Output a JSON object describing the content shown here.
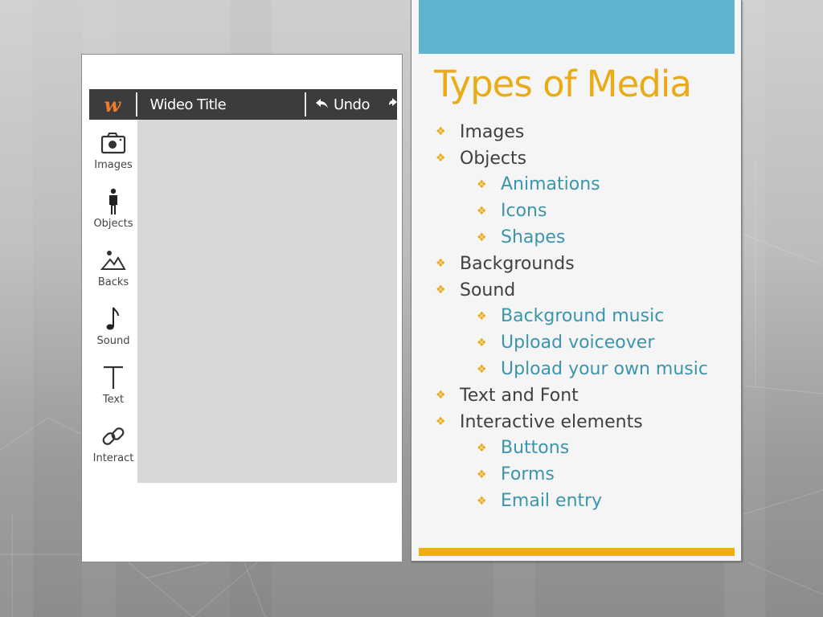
{
  "editor": {
    "logo_glyph": "w",
    "title": "Wideo Title",
    "undo_label": "Undo",
    "undo_icon": "undo-arrow-icon",
    "redo_icon": "redo-arrow-icon",
    "sidebar": [
      {
        "label": "Images",
        "icon": "camera-icon"
      },
      {
        "label": "Objects",
        "icon": "person-icon"
      },
      {
        "label": "Backs",
        "icon": "landscape-icon"
      },
      {
        "label": "Sound",
        "icon": "music-note-icon"
      },
      {
        "label": "Text",
        "icon": "text-t-icon"
      },
      {
        "label": "Interact",
        "icon": "link-icon"
      }
    ]
  },
  "slide": {
    "title": "Types of Media",
    "bullet_glyph": "❖",
    "colors": {
      "band": "#5fb3cc",
      "title": "#e9ab17",
      "level1_text": "#404040",
      "level2_text": "#3a95ad",
      "footer_bar": "#f0ae0c"
    },
    "items": [
      {
        "level": 1,
        "text": "Images"
      },
      {
        "level": 1,
        "text": "Objects"
      },
      {
        "level": 2,
        "text": "Animations"
      },
      {
        "level": 2,
        "text": "Icons"
      },
      {
        "level": 2,
        "text": "Shapes"
      },
      {
        "level": 1,
        "text": "Backgrounds"
      },
      {
        "level": 1,
        "text": "Sound"
      },
      {
        "level": 2,
        "text": "Background music"
      },
      {
        "level": 2,
        "text": "Upload voiceover"
      },
      {
        "level": 2,
        "text": "Upload your own music"
      },
      {
        "level": 1,
        "text": "Text and Font"
      },
      {
        "level": 1,
        "text": "Interactive elements"
      },
      {
        "level": 2,
        "text": "Buttons"
      },
      {
        "level": 2,
        "text": "Forms"
      },
      {
        "level": 2,
        "text": "Email entry"
      }
    ]
  }
}
